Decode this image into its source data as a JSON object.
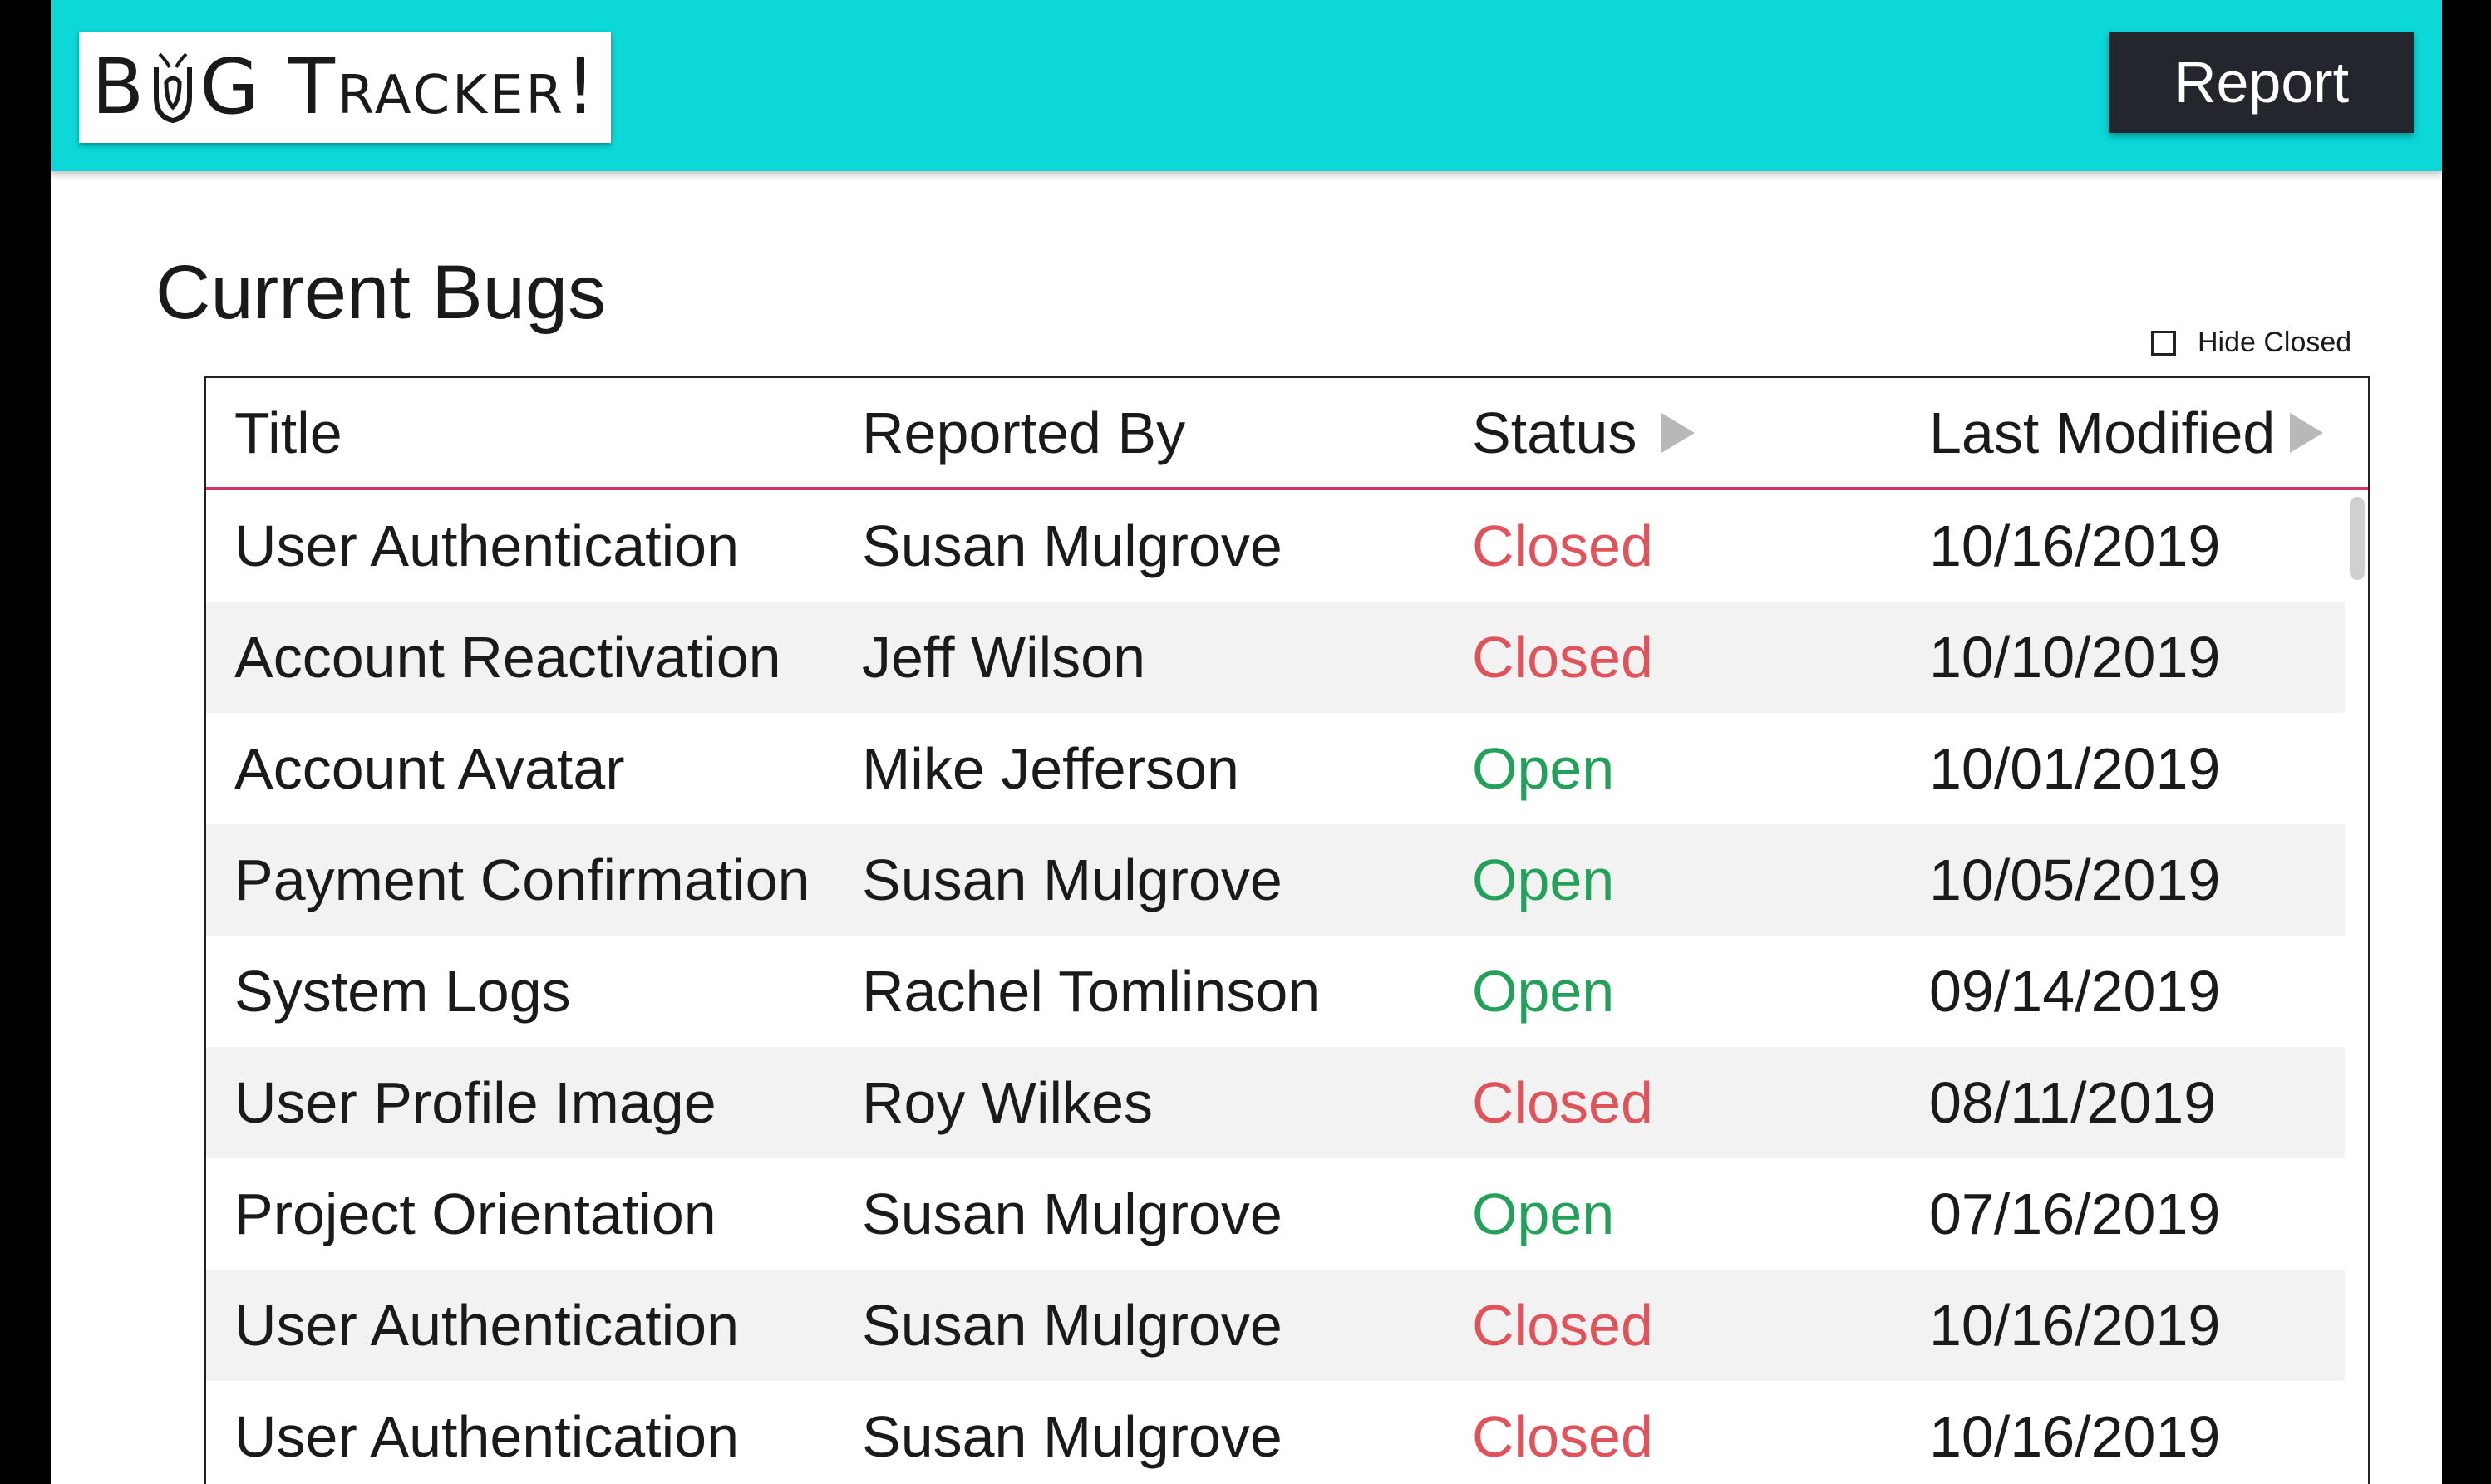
{
  "header": {
    "logo_text": "BUG TRACKER!",
    "logo_part1": "B",
    "logo_part2": "G Tracker!",
    "report_label": "Report",
    "bg_color": "#0cd8d8"
  },
  "page_title": "Current Bugs",
  "hide_closed": {
    "label": "Hide Closed",
    "checked": false
  },
  "table": {
    "columns": [
      "Title",
      "Reported By",
      "Status",
      "Last Modified"
    ],
    "rows": [
      {
        "title": "User Authentication",
        "reported_by": "Susan Mulgrove",
        "status": "Closed",
        "last_modified": "10/16/2019"
      },
      {
        "title": "Account Reactivation",
        "reported_by": "Jeff Wilson",
        "status": "Closed",
        "last_modified": "10/10/2019"
      },
      {
        "title": "Account Avatar",
        "reported_by": "Mike Jefferson",
        "status": "Open",
        "last_modified": "10/01/2019"
      },
      {
        "title": "Payment Confirmation",
        "reported_by": "Susan Mulgrove",
        "status": "Open",
        "last_modified": "10/05/2019"
      },
      {
        "title": "System Logs",
        "reported_by": "Rachel Tomlinson",
        "status": "Open",
        "last_modified": "09/14/2019"
      },
      {
        "title": "User Profile Image",
        "reported_by": "Roy Wilkes",
        "status": "Closed",
        "last_modified": "08/11/2019"
      },
      {
        "title": "Project Orientation",
        "reported_by": "Susan Mulgrove",
        "status": "Open",
        "last_modified": "07/16/2019"
      },
      {
        "title": "User Authentication",
        "reported_by": "Susan Mulgrove",
        "status": "Closed",
        "last_modified": "10/16/2019"
      },
      {
        "title": "User Authentication",
        "reported_by": "Susan Mulgrove",
        "status": "Closed",
        "last_modified": "10/16/2019"
      }
    ]
  },
  "colors": {
    "closed": "#e0535b",
    "open": "#23a05a",
    "header_underline": "#d6336c"
  }
}
